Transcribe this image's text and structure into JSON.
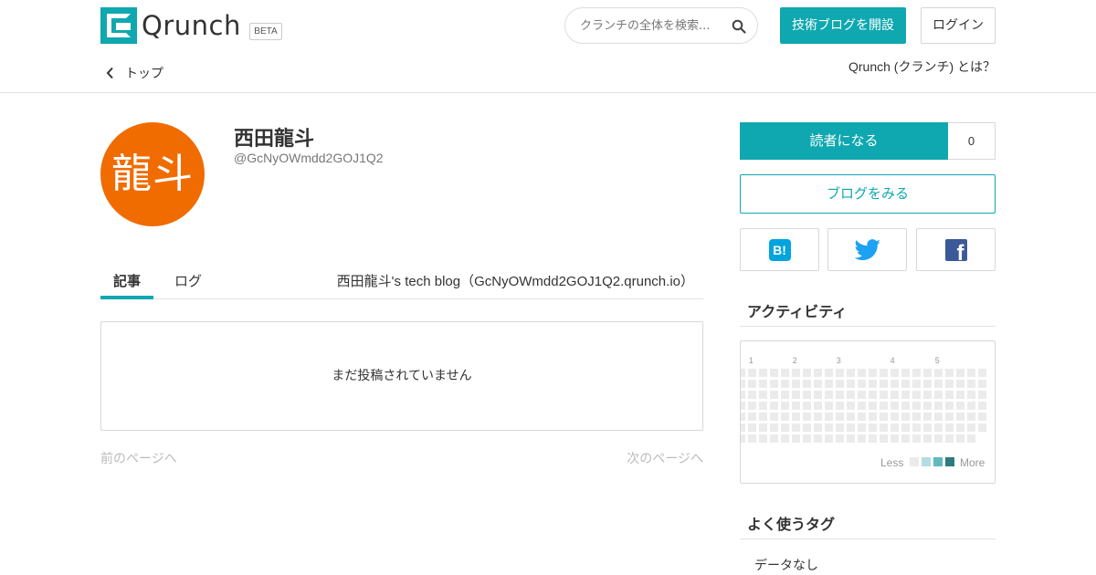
{
  "header": {
    "logo_text": "Qrunch",
    "beta_label": "BETA",
    "search_placeholder": "クランチの全体を検索...",
    "open_blog_label": "技術ブログを開設",
    "login_label": "ログイン",
    "top_link_label": "トップ",
    "about_link_label": "Qrunch (クランチ) とは？"
  },
  "profile": {
    "avatar_text": "龍斗",
    "avatar_color": "#f06c00",
    "name": "西田龍斗",
    "handle": "@GcNyOWmdd2GOJ1Q2"
  },
  "tabs": [
    {
      "label": "記事",
      "active": true
    },
    {
      "label": "ログ",
      "active": false
    }
  ],
  "blog_url_text": "西田龍斗's tech blog（GcNyOWmdd2GOJ1Q2.qrunch.io）",
  "posts_empty_text": "まだ投稿されていません",
  "pagination": {
    "prev_label": "前のページへ",
    "next_label": "次のページへ"
  },
  "sidebar": {
    "follow_label": "読者になる",
    "follow_count": "0",
    "view_blog_label": "ブログをみる",
    "share": [
      {
        "name": "hatena",
        "icon": "hatena-bookmark-icon",
        "glyph": "B!"
      },
      {
        "name": "twitter",
        "icon": "twitter-bird-icon"
      },
      {
        "name": "facebook",
        "icon": "facebook-f-icon",
        "glyph": "f"
      }
    ],
    "activity_title": "アクティビティ",
    "activity": {
      "month_labels": [
        "1",
        "2",
        "3",
        "4",
        "5"
      ],
      "legend_less": "Less",
      "legend_more": "More",
      "legend_colors": [
        "#ebebeb",
        "#b3dde0",
        "#5fb9be",
        "#2f7a7e"
      ],
      "empty_cell_color": "#ebebeb"
    },
    "tags_title": "よく使うタグ",
    "tags_empty_text": "データなし"
  },
  "colors": {
    "accent": "#0fa8b0",
    "text": "#333333",
    "muted": "#bbbbbb"
  }
}
